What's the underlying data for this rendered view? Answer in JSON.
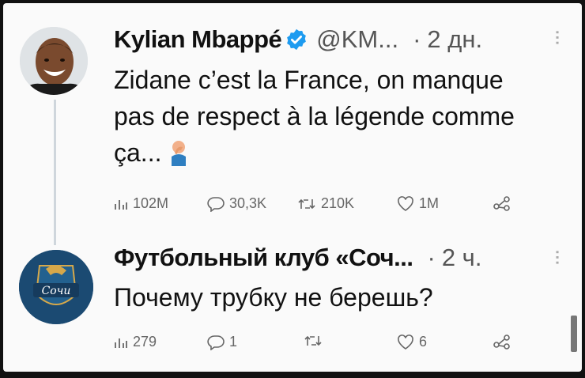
{
  "tweets": [
    {
      "author": "Kylian Mbappé",
      "handle": "@KM...",
      "time": "2 дн.",
      "text_lines": [
        "Zidane c’est la France, on manque",
        "pas de respect à la légende comme",
        "ça..."
      ],
      "stats": {
        "views": "102M",
        "replies": "30,3K",
        "retweets": "210K",
        "likes": "1M"
      }
    },
    {
      "author": "Футбольный клуб «Соч...",
      "time": "2 ч.",
      "avatar_text": "Сочи",
      "text": "Почему трубку не берешь?",
      "stats": {
        "views": "279",
        "replies": "1",
        "retweets": "",
        "likes": "6"
      }
    }
  ],
  "separator": "·",
  "icons": [
    "verified-badge-icon",
    "facepalm-emoji-icon",
    "views-icon",
    "reply-icon",
    "retweet-icon",
    "like-icon",
    "share-icon",
    "more-icon"
  ],
  "colors": {
    "verified": "#1d9bf0",
    "club_blue": "#1b4a72",
    "text": "#111111",
    "muted": "#555555"
  }
}
